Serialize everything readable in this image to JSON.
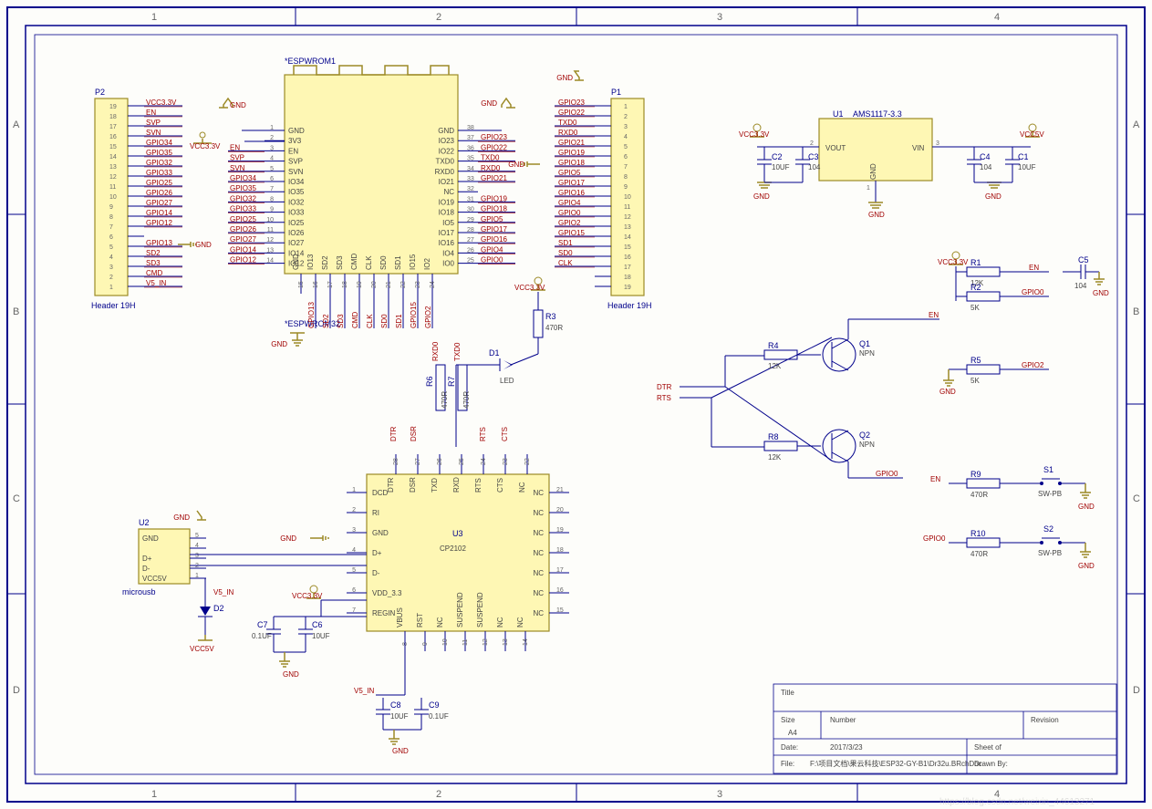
{
  "sheet": {
    "title": "Title",
    "size_lbl": "Size",
    "size": "A4",
    "number_lbl": "Number",
    "number": "",
    "revision_lbl": "Revision",
    "revision": "",
    "date_lbl": "Date:",
    "date": "2017/3/23",
    "sheet_lbl": "Sheet    of",
    "file_lbl": "File:",
    "file": "F:\\项目文档\\果云科技\\ESP32-GY-B1\\Dr32u.BRchDoc",
    "drawn_lbl": "Drawn By:"
  },
  "zones_top": [
    "1",
    "2",
    "3",
    "4"
  ],
  "zones_side": [
    "A",
    "B",
    "C",
    "D"
  ],
  "watermark": "https://blog.csdn.net/weixin_44613271",
  "U1": {
    "ref": "U1",
    "value": "AMS1117-3.3",
    "pins": {
      "vout": "VOUT",
      "vin": "VIN",
      "gnd": "GND"
    },
    "pinno": {
      "vout": "2",
      "vin": "3",
      "gnd": "1"
    },
    "left_pwr": "VCC3.3V",
    "right_pwr": "VCC5V"
  },
  "C1": {
    "ref": "C1",
    "val": "10UF"
  },
  "C2": {
    "ref": "C2",
    "val": "10UF"
  },
  "C3": {
    "ref": "C3",
    "val": "104"
  },
  "C4": {
    "ref": "C4",
    "val": "104"
  },
  "C5": {
    "ref": "C5",
    "val": "104"
  },
  "C6": {
    "ref": "C6",
    "val": "10UF"
  },
  "C7": {
    "ref": "C7",
    "val": "0.1UF"
  },
  "C8": {
    "ref": "C8",
    "val": "10UF"
  },
  "C9": {
    "ref": "C9",
    "val": "0.1UF"
  },
  "R1": {
    "ref": "R1",
    "val": "12K",
    "net": "EN"
  },
  "R2": {
    "ref": "R2",
    "val": "5K",
    "net": "GPIO0"
  },
  "R3": {
    "ref": "R3",
    "val": "470R"
  },
  "R4": {
    "ref": "R4",
    "val": "12K"
  },
  "R5": {
    "ref": "R5",
    "val": "5K",
    "net": "GPIO2"
  },
  "R6": {
    "ref": "R6",
    "val": "470R",
    "net": "RXD0"
  },
  "R7": {
    "ref": "R7",
    "val": "470R",
    "net": "TXD0"
  },
  "R8": {
    "ref": "R8",
    "val": "12K"
  },
  "R9": {
    "ref": "R9",
    "val": "470R",
    "net": "EN"
  },
  "R10": {
    "ref": "R10",
    "val": "470R",
    "net": "GPIO0"
  },
  "Q1": {
    "ref": "Q1",
    "val": "NPN",
    "out": "EN"
  },
  "Q2": {
    "ref": "Q2",
    "val": "NPN",
    "out": "GPIO0"
  },
  "S1": {
    "ref": "S1",
    "val": "SW-PB"
  },
  "S2": {
    "ref": "S2",
    "val": "SW-PB"
  },
  "D1": {
    "ref": "D1",
    "val": "LED"
  },
  "D2": {
    "ref": "D2"
  },
  "DTR": "DTR",
  "RTS": "RTS",
  "DSR": "DSR",
  "CTS": "CTS",
  "GND": "GND",
  "V5IN": "V5_IN",
  "VCC5V": "VCC5V",
  "VCC33": "VCC3.3V",
  "ESP": {
    "ref": "*ESPWROM1",
    "value": "*ESPWROM32",
    "left_pins": [
      {
        "n": "1",
        "name": "GND"
      },
      {
        "n": "2",
        "name": "3V3"
      },
      {
        "n": "3",
        "name": "EN"
      },
      {
        "n": "4",
        "name": "SVP"
      },
      {
        "n": "5",
        "name": "SVN"
      },
      {
        "n": "6",
        "name": "IO34"
      },
      {
        "n": "7",
        "name": "IO35"
      },
      {
        "n": "8",
        "name": "IO32"
      },
      {
        "n": "9",
        "name": "IO33"
      },
      {
        "n": "10",
        "name": "IO25"
      },
      {
        "n": "11",
        "name": "IO26"
      },
      {
        "n": "12",
        "name": "IO27"
      },
      {
        "n": "13",
        "name": "IO14"
      },
      {
        "n": "14",
        "name": "IO12"
      }
    ],
    "left_nets": [
      "",
      "",
      "EN",
      "SVP",
      "SVN",
      "GPIO34",
      "GPIO35",
      "GPIO32",
      "GPIO33",
      "GPIO25",
      "GPIO26",
      "GPIO27",
      "GPIO14",
      "GPIO12"
    ],
    "right_pins": [
      {
        "n": "38",
        "name": "GND"
      },
      {
        "n": "37",
        "name": "IO23"
      },
      {
        "n": "36",
        "name": "IO22"
      },
      {
        "n": "35",
        "name": "TXD0"
      },
      {
        "n": "34",
        "name": "RXD0"
      },
      {
        "n": "33",
        "name": "IO21"
      },
      {
        "n": "32",
        "name": "NC"
      },
      {
        "n": "31",
        "name": "IO19"
      },
      {
        "n": "30",
        "name": "IO18"
      },
      {
        "n": "29",
        "name": "IO5"
      },
      {
        "n": "28",
        "name": "IO17"
      },
      {
        "n": "27",
        "name": "IO16"
      },
      {
        "n": "26",
        "name": "IO4"
      },
      {
        "n": "25",
        "name": "IO0"
      }
    ],
    "right_nets": [
      "",
      "GPIO23",
      "GPIO22",
      "TXD0",
      "RXD0",
      "GPIO21",
      "",
      "GPIO19",
      "GPIO18",
      "GPIO5",
      "GPIO17",
      "GPIO16",
      "GPIO4",
      "GPIO0"
    ],
    "bot_pins": [
      {
        "n": "15",
        "name": "GND"
      },
      {
        "n": "16",
        "name": "IO13"
      },
      {
        "n": "17",
        "name": "SD2"
      },
      {
        "n": "18",
        "name": "SD3"
      },
      {
        "n": "19",
        "name": "CMD"
      },
      {
        "n": "20",
        "name": "CLK"
      },
      {
        "n": "21",
        "name": "SD0"
      },
      {
        "n": "22",
        "name": "SD1"
      },
      {
        "n": "23",
        "name": "IO15"
      },
      {
        "n": "24",
        "name": "IO2"
      }
    ],
    "bot_nets": [
      "",
      "GPIO13",
      "SD2",
      "SD3",
      "CMD",
      "CLK",
      "SD0",
      "SD1",
      "GPIO15",
      "GPIO2"
    ],
    "left_pwr": "VCC3.3V",
    "left_gnd": "GND",
    "right_gnd": "GND",
    "bot_gnd": "GND"
  },
  "P1": {
    "ref": "P1",
    "value": "Header 19H",
    "nets": [
      "GPIO23",
      "GPIO22",
      "TXD0",
      "RXD0",
      "GPIO21",
      "GPIO19",
      "GPIO18",
      "GPIO5",
      "GPIO17",
      "GPIO16",
      "GPIO4",
      "GPIO0",
      "GPIO2",
      "GPIO15",
      "SD1",
      "SD0",
      "CLK",
      "",
      ""
    ],
    "pins": [
      "1",
      "2",
      "3",
      "4",
      "5",
      "6",
      "7",
      "8",
      "9",
      "10",
      "11",
      "12",
      "13",
      "14",
      "15",
      "16",
      "17",
      "18",
      "19"
    ],
    "gnd_lbl": "GND",
    "side_gnd": "GND"
  },
  "P2": {
    "ref": "P2",
    "value": "Header 19H",
    "nets": [
      "VCC3.3V",
      "EN",
      "SVP",
      "SVN",
      "GPIO34",
      "GPIO35",
      "GPIO32",
      "GPIO33",
      "GPIO25",
      "GPIO26",
      "GPIO27",
      "GPIO14",
      "GPIO12",
      "",
      "GPIO13",
      "SD2",
      "SD3",
      "CMD",
      "V5_IN"
    ],
    "pins": [
      "19",
      "18",
      "17",
      "16",
      "15",
      "14",
      "13",
      "12",
      "11",
      "10",
      "9",
      "8",
      "7",
      "6",
      "5",
      "4",
      "3",
      "2",
      "1"
    ],
    "side_gnd": "GND"
  },
  "U2": {
    "ref": "U2",
    "value": "microusb",
    "pins": [
      {
        "n": "5",
        "name": "GND"
      },
      {
        "n": "4",
        "name": ""
      },
      {
        "n": "3",
        "name": "D+"
      },
      {
        "n": "2",
        "name": "D-"
      },
      {
        "n": "1",
        "name": "VCC5V"
      }
    ],
    "gnd": "GND",
    "v5": "V5_IN",
    "vcc5v": "VCC5V"
  },
  "U3": {
    "ref": "U3",
    "value": "CP2102",
    "left_pins": [
      {
        "n": "1",
        "name": "DCD"
      },
      {
        "n": "2",
        "name": "RI"
      },
      {
        "n": "3",
        "name": "GND"
      },
      {
        "n": "4",
        "name": "D+"
      },
      {
        "n": "5",
        "name": "D-"
      },
      {
        "n": "6",
        "name": "VDD_3.3"
      },
      {
        "n": "7",
        "name": "REGIN"
      }
    ],
    "top_pins": [
      {
        "n": "28",
        "name": "DTR"
      },
      {
        "n": "27",
        "name": "DSR"
      },
      {
        "n": "26",
        "name": "TXD"
      },
      {
        "n": "25",
        "name": "RXD"
      },
      {
        "n": "24",
        "name": "RTS"
      },
      {
        "n": "23",
        "name": "CTS"
      },
      {
        "n": "22",
        "name": "NC"
      }
    ],
    "right_pins": [
      {
        "n": "21",
        "name": "NC"
      },
      {
        "n": "20",
        "name": "NC"
      },
      {
        "n": "19",
        "name": "NC"
      },
      {
        "n": "18",
        "name": "NC"
      },
      {
        "n": "17",
        "name": "NC"
      },
      {
        "n": "16",
        "name": "NC"
      },
      {
        "n": "15",
        "name": "NC"
      }
    ],
    "bot_pins": [
      {
        "n": "8",
        "name": "VBUS"
      },
      {
        "n": "9",
        "name": "RST"
      },
      {
        "n": "10",
        "name": "NC"
      },
      {
        "n": "11",
        "name": "SUSPEND"
      },
      {
        "n": "12",
        "name": "SUSPEND"
      },
      {
        "n": "13",
        "name": "NC"
      },
      {
        "n": "14",
        "name": "NC"
      }
    ],
    "left_gnd": "GND",
    "left_pwr": "VCC3.3V"
  }
}
